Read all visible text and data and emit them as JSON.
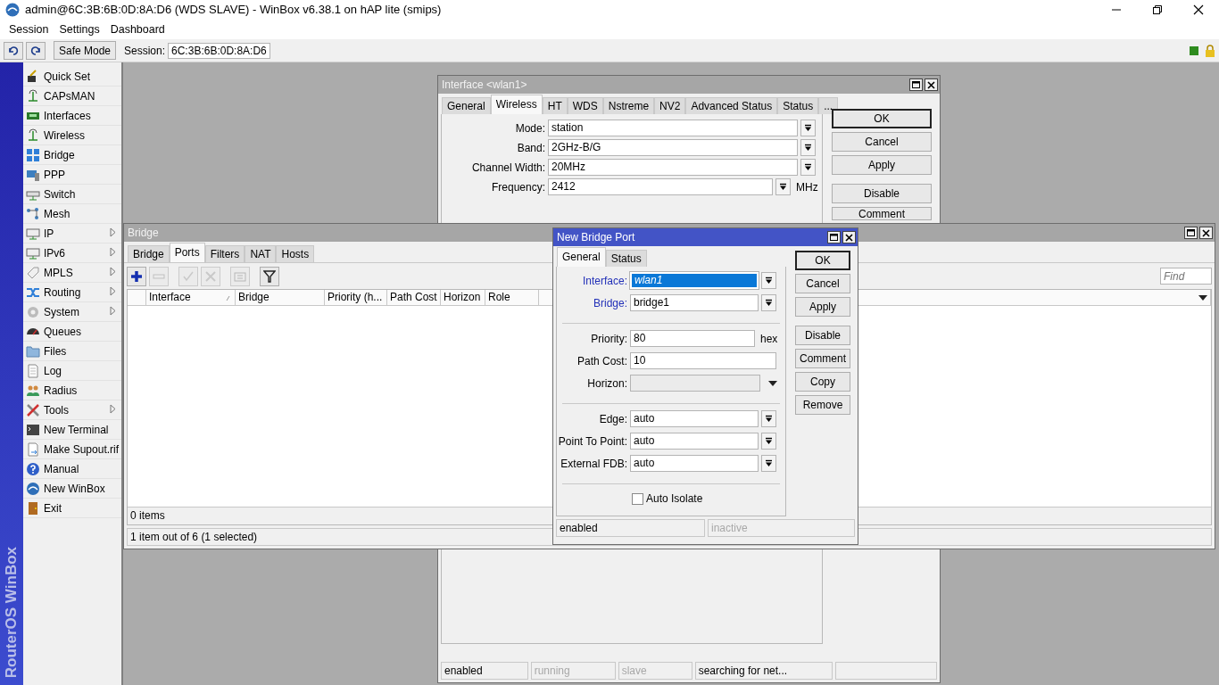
{
  "app": {
    "title": "admin@6C:3B:6B:0D:8A:D6 (WDS SLAVE) - WinBox v6.38.1 on hAP lite (smips)",
    "menu": [
      "Session",
      "Settings",
      "Dashboard"
    ],
    "safe_mode": "Safe Mode",
    "session_label": "Session:",
    "session_value": "6C:3B:6B:0D:8A:D6",
    "brand": "RouterOS WinBox"
  },
  "sidebar": {
    "items": [
      {
        "label": "Quick Set",
        "submenu": false
      },
      {
        "label": "CAPsMAN",
        "submenu": false
      },
      {
        "label": "Interfaces",
        "submenu": false
      },
      {
        "label": "Wireless",
        "submenu": false
      },
      {
        "label": "Bridge",
        "submenu": false
      },
      {
        "label": "PPP",
        "submenu": false
      },
      {
        "label": "Switch",
        "submenu": false
      },
      {
        "label": "Mesh",
        "submenu": false
      },
      {
        "label": "IP",
        "submenu": true
      },
      {
        "label": "IPv6",
        "submenu": true
      },
      {
        "label": "MPLS",
        "submenu": true
      },
      {
        "label": "Routing",
        "submenu": true
      },
      {
        "label": "System",
        "submenu": true
      },
      {
        "label": "Queues",
        "submenu": false
      },
      {
        "label": "Files",
        "submenu": false
      },
      {
        "label": "Log",
        "submenu": false
      },
      {
        "label": "Radius",
        "submenu": false
      },
      {
        "label": "Tools",
        "submenu": true
      },
      {
        "label": "New Terminal",
        "submenu": false
      },
      {
        "label": "Make Supout.rif",
        "submenu": false
      },
      {
        "label": "Manual",
        "submenu": false
      },
      {
        "label": "New WinBox",
        "submenu": false
      },
      {
        "label": "Exit",
        "submenu": false
      }
    ]
  },
  "interface_window": {
    "title": "Interface <wlan1>",
    "active": false,
    "tabs": [
      {
        "label": "General",
        "selected": false
      },
      {
        "label": "Wireless",
        "selected": true
      },
      {
        "label": "HT",
        "selected": false
      },
      {
        "label": "WDS",
        "selected": false
      },
      {
        "label": "Nstreme",
        "selected": false
      },
      {
        "label": "NV2",
        "selected": false
      },
      {
        "label": "Advanced Status",
        "selected": false
      },
      {
        "label": "Status",
        "selected": false
      },
      {
        "label": "...",
        "selected": false
      }
    ],
    "fields": [
      {
        "label": "Mode:",
        "value": "station"
      },
      {
        "label": "Band:",
        "value": "2GHz-B/G"
      },
      {
        "label": "Channel Width:",
        "value": "20MHz"
      },
      {
        "label": "Frequency:",
        "value": "2412",
        "unit": "MHz"
      }
    ],
    "buttons": [
      {
        "label": "OK",
        "default": true
      },
      {
        "label": "Cancel",
        "default": false
      },
      {
        "label": "Apply",
        "default": false
      },
      {
        "label": "Disable",
        "default": false
      },
      {
        "label": "Comment",
        "default": false
      }
    ],
    "status": [
      {
        "text": "enabled",
        "disabled": false
      },
      {
        "text": "running",
        "disabled": true
      },
      {
        "text": "slave",
        "disabled": true
      },
      {
        "text": "searching for net...",
        "disabled": false
      }
    ]
  },
  "bridge_window": {
    "title": "Bridge",
    "active": false,
    "tabs": [
      {
        "label": "Bridge",
        "selected": false
      },
      {
        "label": "Ports",
        "selected": true
      },
      {
        "label": "Filters",
        "selected": false
      },
      {
        "label": "NAT",
        "selected": false
      },
      {
        "label": "Hosts",
        "selected": false
      }
    ],
    "tools": [
      {
        "kind": "add",
        "disabled": false
      },
      {
        "kind": "remove",
        "disabled": true
      },
      {
        "kind": "enable",
        "disabled": true
      },
      {
        "kind": "disable",
        "disabled": true
      },
      {
        "kind": "comment",
        "disabled": true
      },
      {
        "kind": "filter",
        "disabled": false
      }
    ],
    "find_placeholder": "Find",
    "columns": [
      {
        "label": "Interface",
        "sorted": true
      },
      {
        "label": "Bridge",
        "sorted": false
      },
      {
        "label": "Priority (h...",
        "sorted": false
      },
      {
        "label": "Path Cost",
        "sorted": false
      },
      {
        "label": "Horizon",
        "sorted": false
      },
      {
        "label": "Role",
        "sorted": false
      }
    ],
    "footer": "0 items",
    "status": "1 item out of 6 (1 selected)"
  },
  "port_window": {
    "title": "New Bridge Port",
    "active": true,
    "tabs": [
      {
        "label": "General",
        "selected": true
      },
      {
        "label": "Status",
        "selected": false
      }
    ],
    "groups": [
      [
        {
          "kind": "select",
          "label": "Interface:",
          "value": "wlan1",
          "required": true,
          "highlighted": true
        },
        {
          "kind": "select",
          "label": "Bridge:",
          "value": "bridge1",
          "required": true,
          "highlighted": false
        }
      ],
      [
        {
          "kind": "text",
          "label": "Priority:",
          "value": "80",
          "unit": "hex",
          "required": false,
          "highlighted": false
        },
        {
          "kind": "text",
          "label": "Path Cost:",
          "value": "10",
          "required": false,
          "highlighted": false
        },
        {
          "kind": "optional",
          "label": "Horizon:",
          "required": false,
          "highlighted": false
        }
      ],
      [
        {
          "kind": "select",
          "label": "Edge:",
          "value": "auto",
          "required": false,
          "highlighted": false
        },
        {
          "kind": "select",
          "label": "Point To Point:",
          "value": "auto",
          "required": false,
          "highlighted": false
        },
        {
          "kind": "select",
          "label": "External FDB:",
          "value": "auto",
          "required": false,
          "highlighted": false
        }
      ]
    ],
    "checkbox": {
      "label": "Auto Isolate",
      "checked": false
    },
    "buttons": [
      {
        "label": "OK",
        "default": true
      },
      {
        "label": "Cancel",
        "default": false
      },
      {
        "label": "Apply",
        "default": false
      },
      {
        "label": "Disable",
        "default": false
      },
      {
        "label": "Comment",
        "default": false
      },
      {
        "label": "Copy",
        "default": false
      },
      {
        "label": "Remove",
        "default": false
      }
    ],
    "status": [
      {
        "text": "enabled",
        "disabled": false
      },
      {
        "text": "inactive",
        "disabled": true
      }
    ]
  }
}
